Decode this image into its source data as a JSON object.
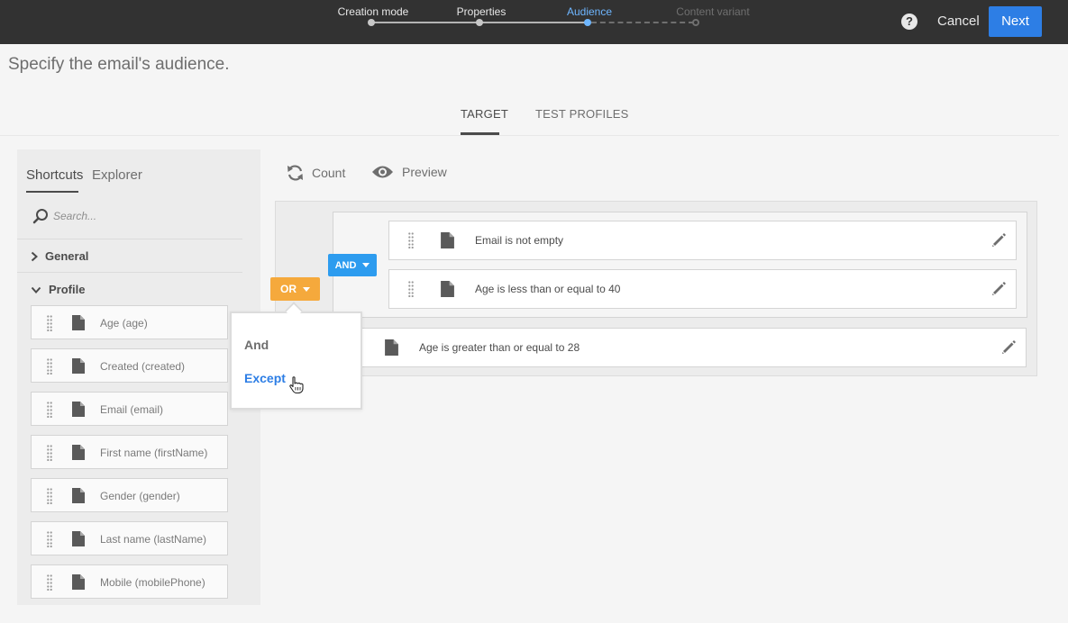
{
  "wizard": {
    "steps": [
      {
        "label": "Creation mode",
        "state": "done"
      },
      {
        "label": "Properties",
        "state": "done"
      },
      {
        "label": "Audience",
        "state": "active"
      },
      {
        "label": "Content variant",
        "state": "future"
      }
    ],
    "help_icon": "help-icon",
    "cancel_label": "Cancel",
    "next_label": "Next",
    "accent_color": "#2d7ee5",
    "active_step_color": "#6eb6ff"
  },
  "page": {
    "title": "Specify the email's audience."
  },
  "tabs": [
    {
      "label": "TARGET",
      "active": true
    },
    {
      "label": "TEST PROFILES",
      "active": false
    }
  ],
  "palette": {
    "tabs": [
      {
        "label": "Shortcuts",
        "active": true
      },
      {
        "label": "Explorer",
        "active": false
      }
    ],
    "search_placeholder": "Search...",
    "sections": [
      {
        "label": "General",
        "expanded": false
      },
      {
        "label": "Profile",
        "expanded": true
      }
    ],
    "fields": [
      "Age (age)",
      "Created (created)",
      "Email (email)",
      "First name (firstName)",
      "Gender (gender)",
      "Last name (lastName)",
      "Mobile (mobilePhone)"
    ]
  },
  "toolbar": {
    "count_label": "Count",
    "preview_label": "Preview"
  },
  "query": {
    "or_label": "OR",
    "or_color": "#f5a93c",
    "and_label": "AND",
    "and_color": "#2d9cef",
    "conditions": [
      "Email is not empty",
      "Age is less than or equal to 40",
      "Age is greater than or equal to 28"
    ]
  },
  "operator_menu": {
    "items": [
      "And",
      "Except"
    ],
    "hovered": "Except"
  }
}
